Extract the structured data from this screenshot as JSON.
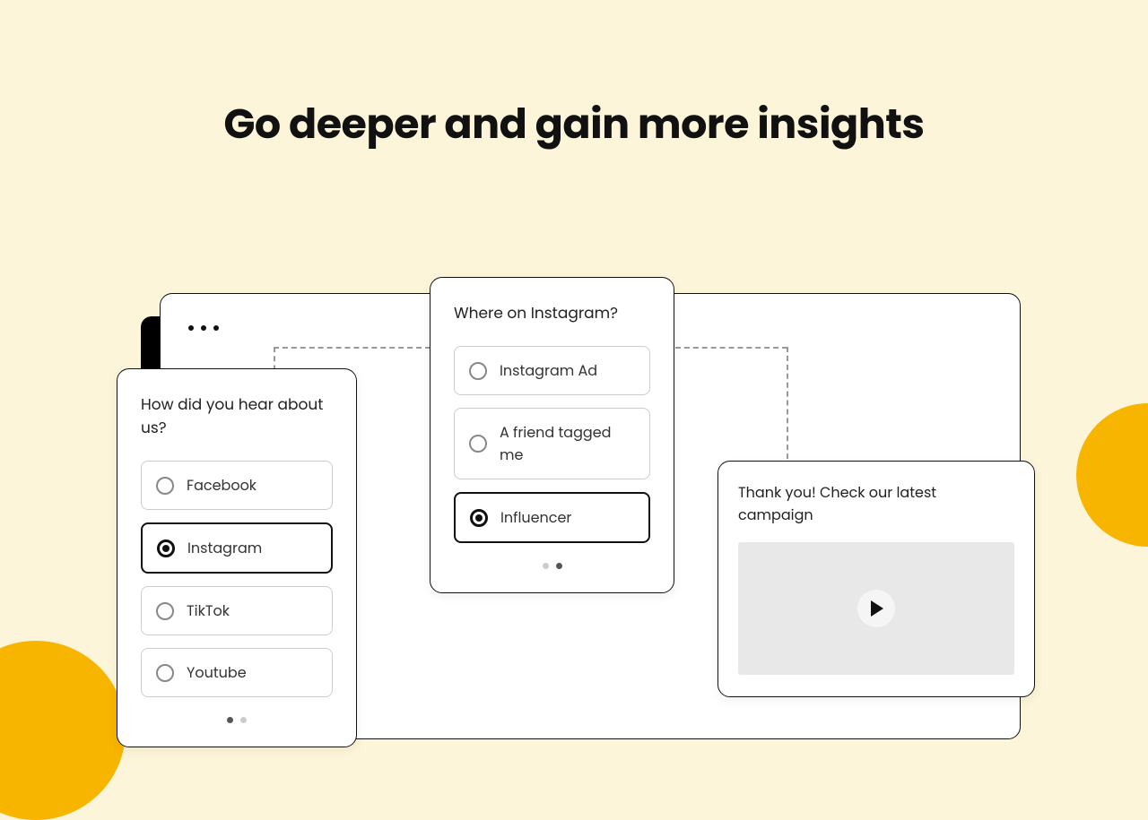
{
  "heading": "Go deeper and gain more insights",
  "card1": {
    "question": "How did you hear about us?",
    "options": [
      "Facebook",
      "Instagram",
      "TikTok",
      "Youtube"
    ],
    "selected": 1,
    "page_active": 0
  },
  "card2": {
    "question": "Where on Instagram?",
    "options": [
      "Instagram Ad",
      "A friend tagged me",
      "Influencer"
    ],
    "selected": 2,
    "page_active": 1
  },
  "card3": {
    "message": "Thank you! Check our latest campaign"
  }
}
